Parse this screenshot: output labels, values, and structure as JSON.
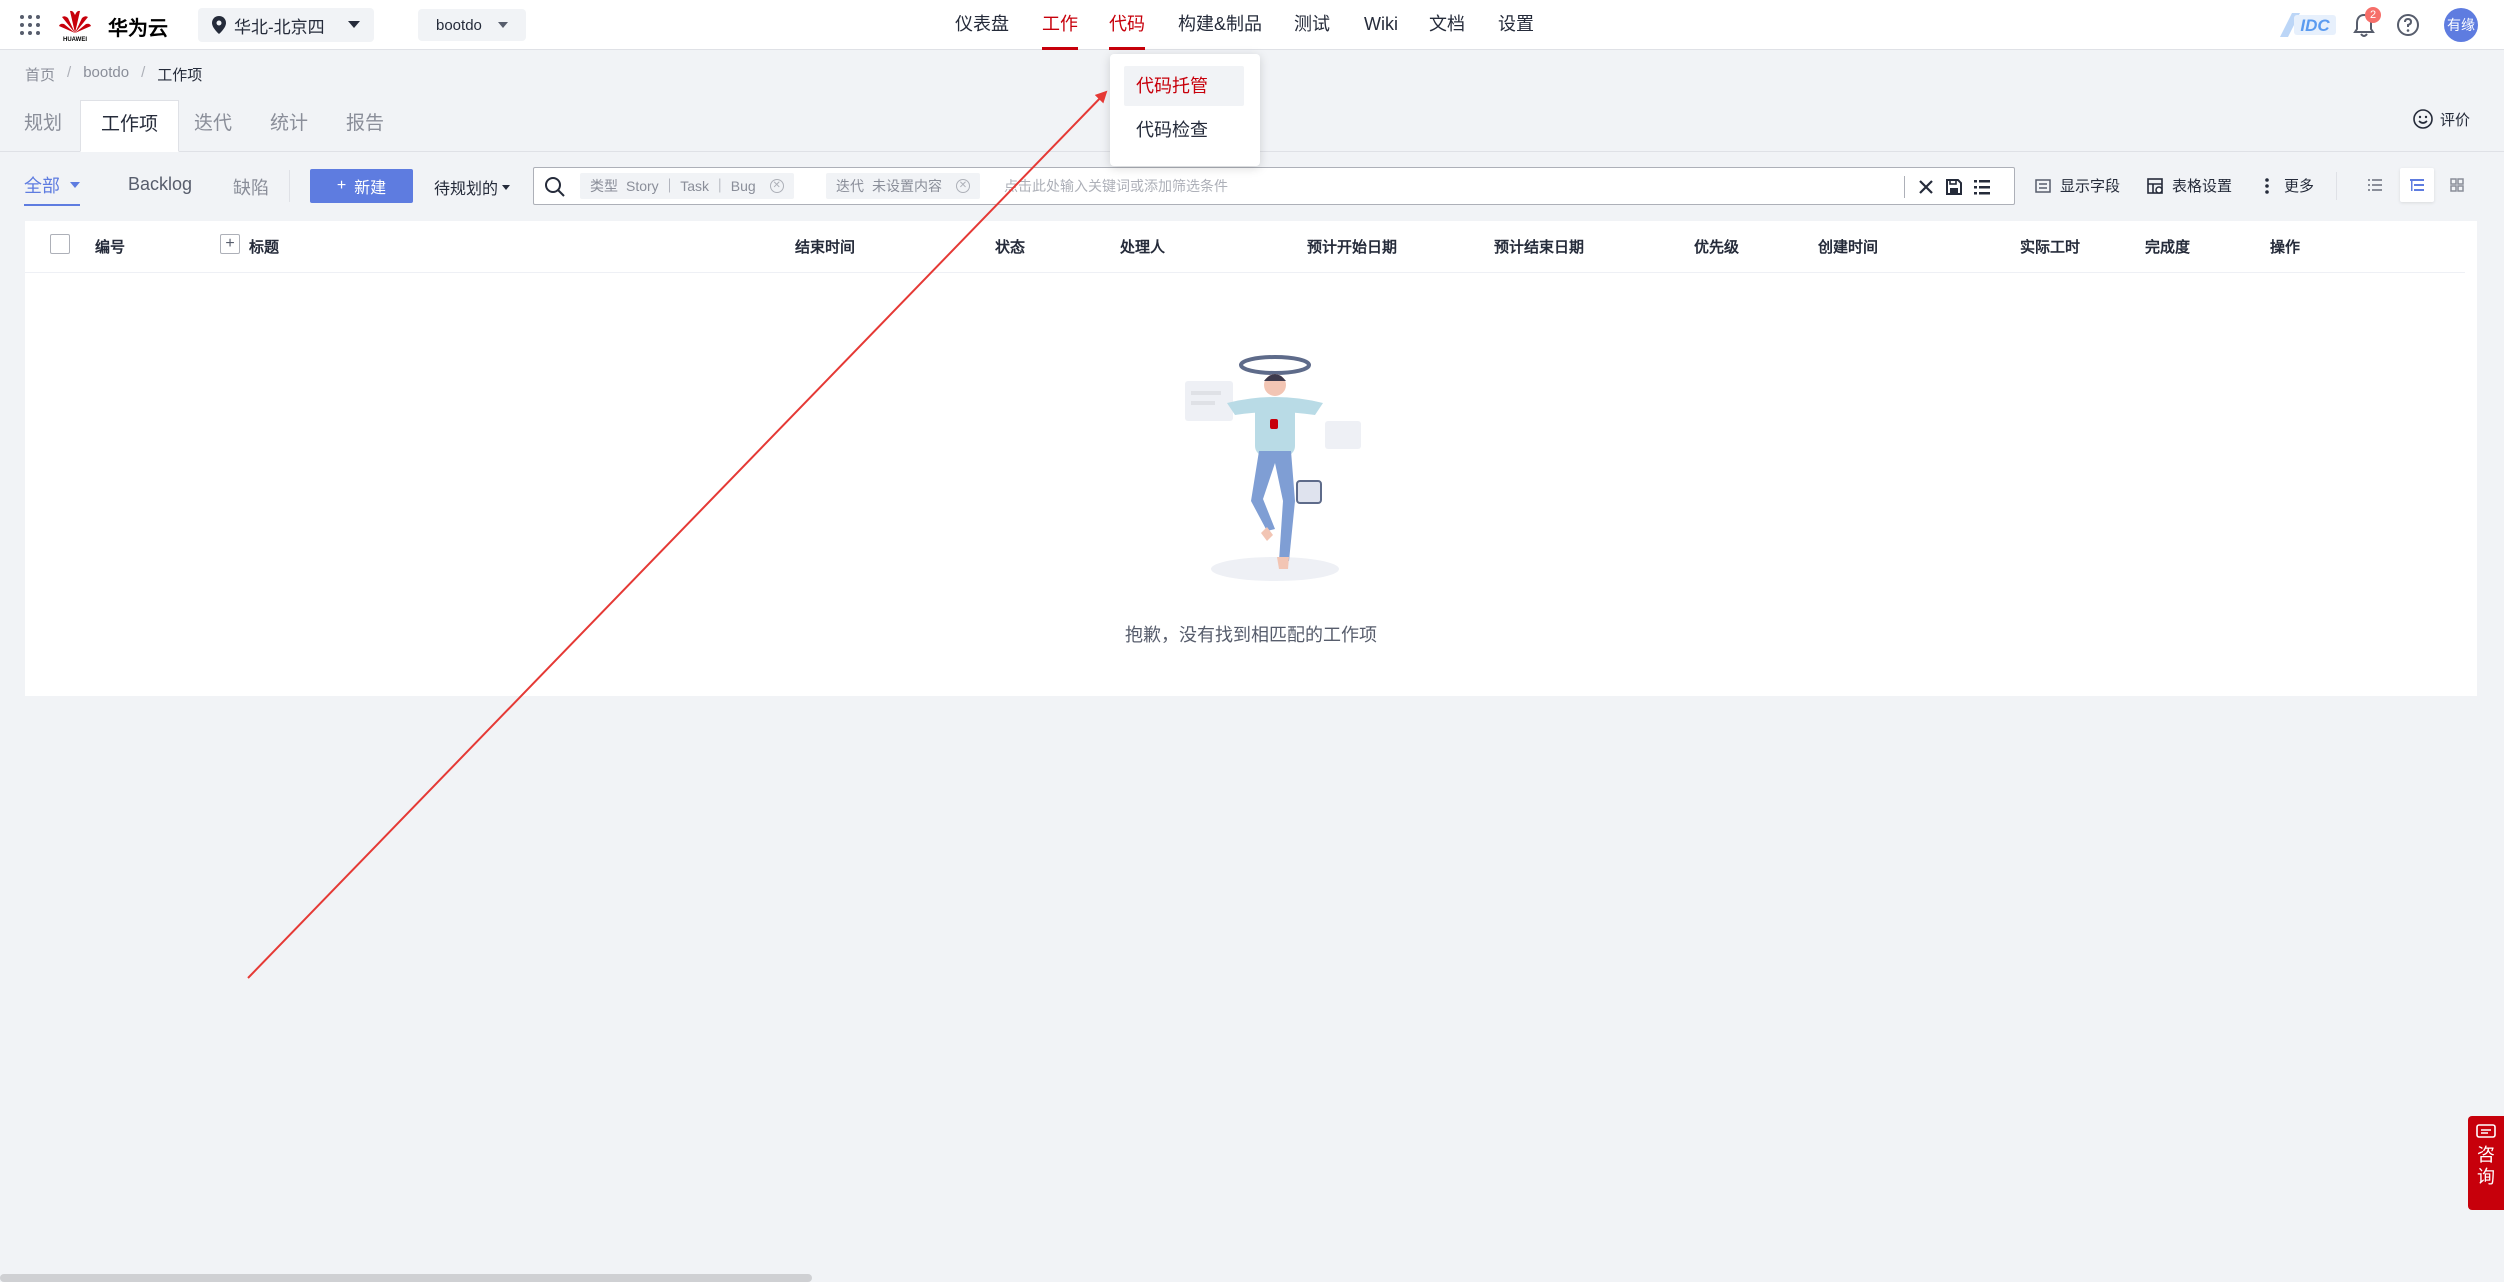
{
  "header": {
    "brand": "华为云",
    "logo_text": "HUAWEI",
    "region": "华北-北京四",
    "project": "bootdo",
    "nav": [
      {
        "label": "仪表盘",
        "active": false
      },
      {
        "label": "工作",
        "active": true
      },
      {
        "label": "代码",
        "active": true
      },
      {
        "label": "构建&制品",
        "active": false
      },
      {
        "label": "测试",
        "active": false
      },
      {
        "label": "Wiki",
        "active": false
      },
      {
        "label": "文档",
        "active": false
      },
      {
        "label": "设置",
        "active": false
      }
    ],
    "idc_logo": "IDC",
    "notifications": "2",
    "avatar": "有缘"
  },
  "code_menu": {
    "items": [
      {
        "label": "代码托管",
        "active": true
      },
      {
        "label": "代码检查",
        "active": false
      }
    ]
  },
  "breadcrumb": {
    "home": "首页",
    "project": "bootdo",
    "current": "工作项",
    "sep": "/"
  },
  "subtabs": [
    "规划",
    "工作项",
    "迭代",
    "统计",
    "报告"
  ],
  "rate": "评价",
  "toolbar": {
    "filters": [
      "全部",
      "Backlog",
      "缺陷"
    ],
    "new_button": "新建",
    "plan_dropdown": "待规划的",
    "type_tag": {
      "key": "类型",
      "value": "Story ｜ Task ｜ Bug"
    },
    "sprint_tag": {
      "key": "迭代",
      "value": "未设置内容"
    },
    "search_placeholder": "点击此处输入关键词或添加筛选条件",
    "show_fields": "显示字段",
    "table_settings": "表格设置",
    "more": "更多"
  },
  "table": {
    "columns": [
      "编号",
      "标题",
      "结束时间",
      "状态",
      "处理人",
      "预计开始日期",
      "预计结束日期",
      "优先级",
      "创建时间",
      "实际工时",
      "完成度",
      "操作"
    ],
    "empty_text": "抱歉，没有找到相匹配的工作项"
  },
  "consult": [
    "咨",
    "询"
  ],
  "colors": {
    "brand_red": "#c7000b",
    "primary": "#5e7ce0",
    "background": "#f1f3f6",
    "annotation_arrow": "#e53935"
  }
}
